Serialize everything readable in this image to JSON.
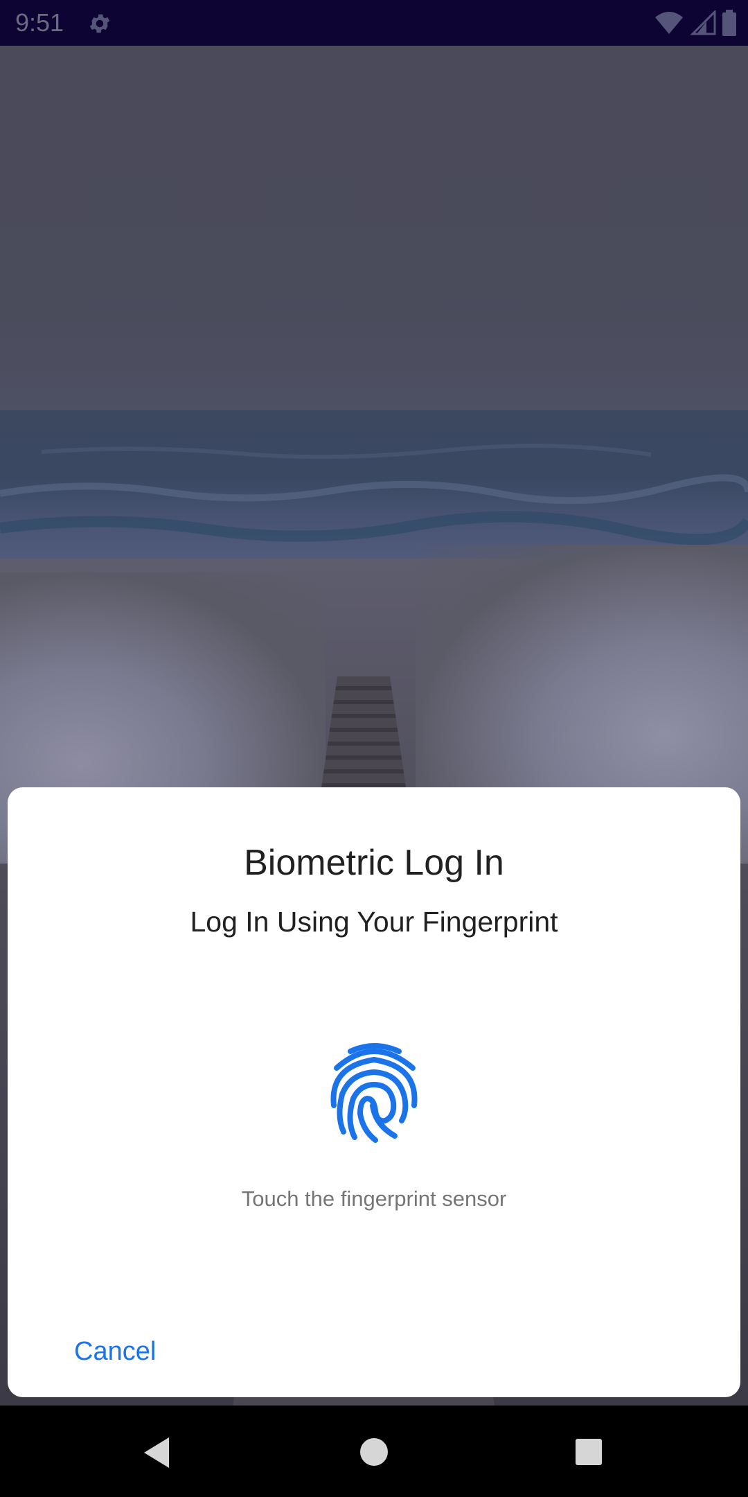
{
  "status_bar": {
    "time": "9:51",
    "icons": [
      "settings-gear-icon",
      "wifi-icon",
      "cell-signal-icon",
      "battery-icon"
    ],
    "background": "#0d0433"
  },
  "dialog": {
    "title": "Biometric Log In",
    "subtitle": "Log In Using Your Fingerprint",
    "icon": "fingerprint-icon",
    "hint": "Touch the fingerprint sensor",
    "cancel_label": "Cancel",
    "accent_color": "#1a73e8"
  },
  "nav_bar": {
    "icons": [
      "back-icon",
      "home-icon",
      "recents-icon"
    ]
  }
}
